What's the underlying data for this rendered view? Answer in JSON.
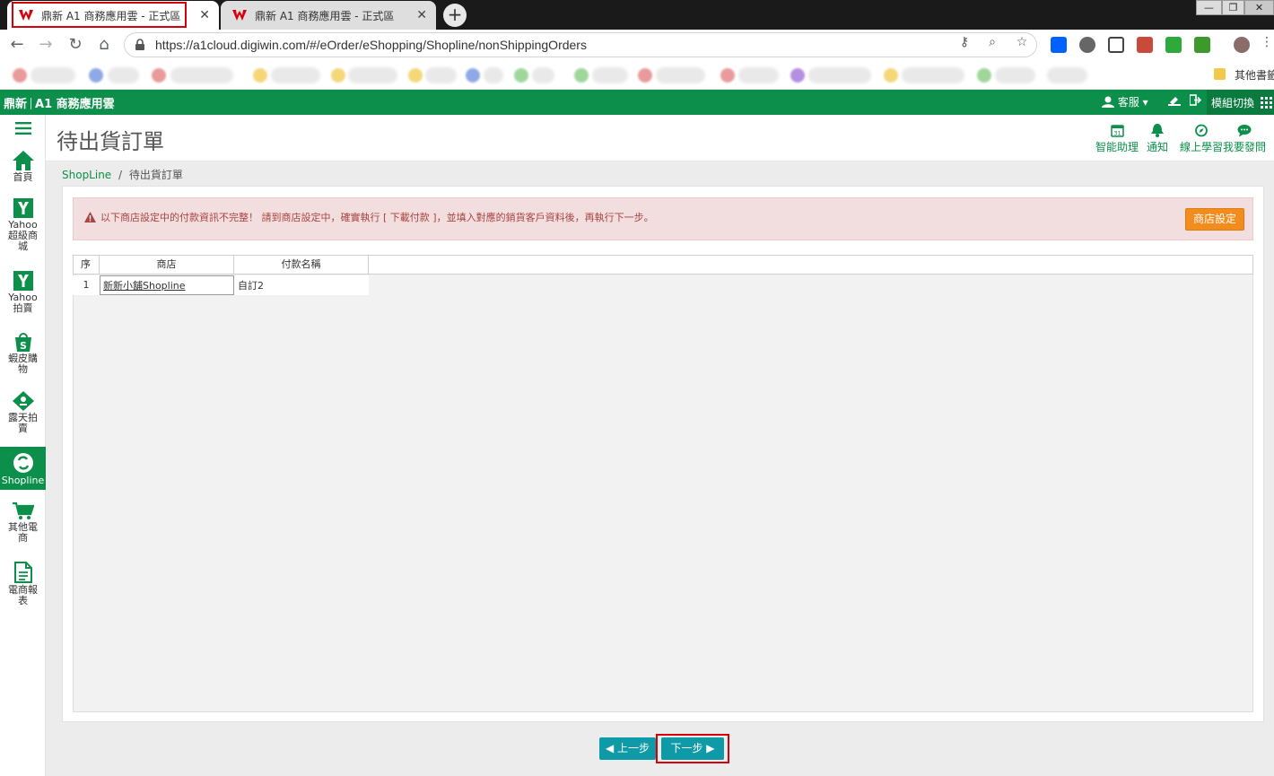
{
  "browser": {
    "tabs": [
      {
        "title": "鼎新 A1 商務應用雲 - 正式區",
        "active": true
      },
      {
        "title": "鼎新 A1 商務應用雲 - 正式區",
        "active": false
      }
    ],
    "close_glyph": "✕",
    "new_tab_glyph": "+",
    "url": "https://a1cloud.digiwin.com/#/eOrder/eShopping/Shopline/nonShippingOrders",
    "bookmark_other": "其他書籤",
    "window_controls": [
      "—",
      "❐",
      "✕"
    ]
  },
  "app": {
    "brand_left": "鼎新",
    "brand_right": "A1 商務應用雲",
    "service_label": "客服",
    "module_switch_label": "模組切換"
  },
  "sidebar": {
    "items": [
      {
        "label": "首頁",
        "icon": "home-icon"
      },
      {
        "label": "Yahoo超級商城",
        "icon": "yahoo-y-icon"
      },
      {
        "label": "Yahoo拍賣",
        "icon": "yahoo-y-icon"
      },
      {
        "label": "蝦皮購物",
        "icon": "shopee-bag-icon"
      },
      {
        "label": "露天拍賣",
        "icon": "ruten-icon"
      },
      {
        "label": "Shopline",
        "icon": "shopline-icon"
      },
      {
        "label": "其他電商",
        "icon": "cart-icon"
      },
      {
        "label": "電商報表",
        "icon": "report-icon"
      }
    ]
  },
  "page": {
    "title": "待出貨訂單",
    "tools": [
      {
        "label": "智能助理",
        "icon": "calendar-icon"
      },
      {
        "label": "通知",
        "icon": "bell-icon"
      },
      {
        "label": "線上學習",
        "icon": "compass-icon"
      },
      {
        "label": "我要發問",
        "icon": "chat-icon"
      }
    ],
    "breadcrumb": {
      "parent": "ShopLine",
      "separator": "/",
      "current": "待出貨訂單"
    }
  },
  "alert": {
    "message": "以下商店設定中的付款資訊不完整！ 請到商店設定中，確實執行 [ 下載付款 ]，並填入對應的銷貨客戶資料後，再執行下一步。",
    "button_label": "商店設定"
  },
  "table": {
    "headers": [
      "序",
      "商店",
      "付款名稱"
    ],
    "rows": [
      {
        "seq": "1",
        "store": "新新小舖Shopline",
        "payment": "自訂2"
      }
    ]
  },
  "pager": {
    "prev_label": "上一步",
    "next_label": "下一步"
  },
  "colors": {
    "brand_green": "#0b8f4a",
    "alert_text": "#a94442",
    "alert_bg": "#f2dede",
    "store_button": "#f28c1c",
    "pager_button": "#0e9aa7",
    "highlight_red": "#d6000c"
  }
}
